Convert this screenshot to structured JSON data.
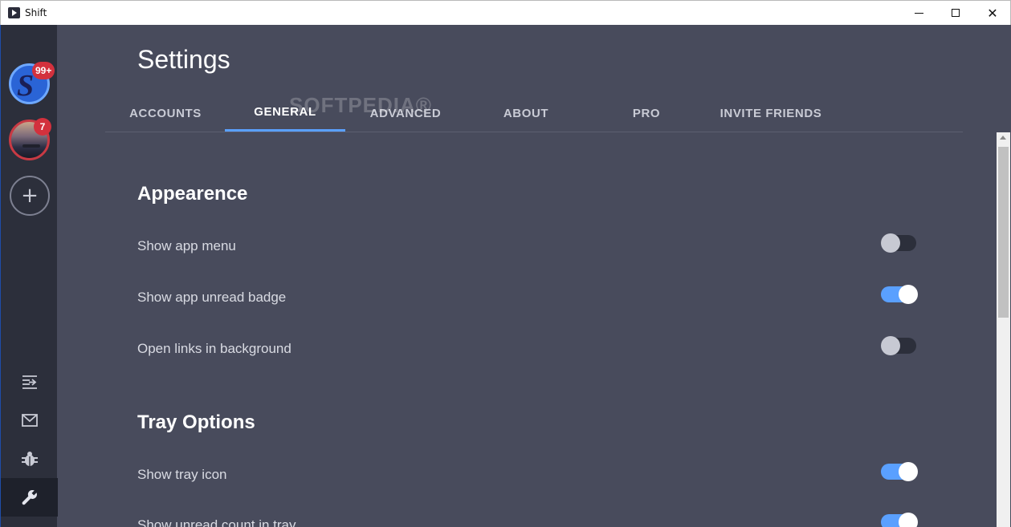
{
  "window": {
    "title": "Shift",
    "minimize_glyph": "",
    "close_glyph": "✕"
  },
  "sidebar": {
    "accounts": [
      {
        "badge": "99+"
      },
      {
        "badge": "7"
      }
    ],
    "add_glyph": "+",
    "icons": [
      "menu-arrow-icon",
      "mail-icon",
      "bug-icon",
      "wrench-icon"
    ]
  },
  "page": {
    "title": "Settings"
  },
  "tabs": [
    {
      "label": "ACCOUNTS",
      "active": false
    },
    {
      "label": "GENERAL",
      "active": true
    },
    {
      "label": "ADVANCED",
      "active": false
    },
    {
      "label": "ABOUT",
      "active": false
    },
    {
      "label": "PRO",
      "active": false
    },
    {
      "label": "INVITE FRIENDS",
      "active": false
    }
  ],
  "watermark": "SOFTPEDIA®",
  "sections": {
    "appearance": {
      "title": "Appearence",
      "rows": [
        {
          "label": "Show app menu",
          "enabled": false
        },
        {
          "label": "Show app unread badge",
          "enabled": true
        },
        {
          "label": "Open links in background",
          "enabled": false
        }
      ]
    },
    "tray": {
      "title": "Tray Options",
      "rows": [
        {
          "label": "Show tray icon",
          "enabled": true
        },
        {
          "label": "Show unread count in tray",
          "enabled": true
        }
      ]
    }
  },
  "colors": {
    "accent": "#5aa0ff",
    "background": "#484b5c",
    "sidebar": "#2c2f3b",
    "badge": "#d3313d"
  }
}
